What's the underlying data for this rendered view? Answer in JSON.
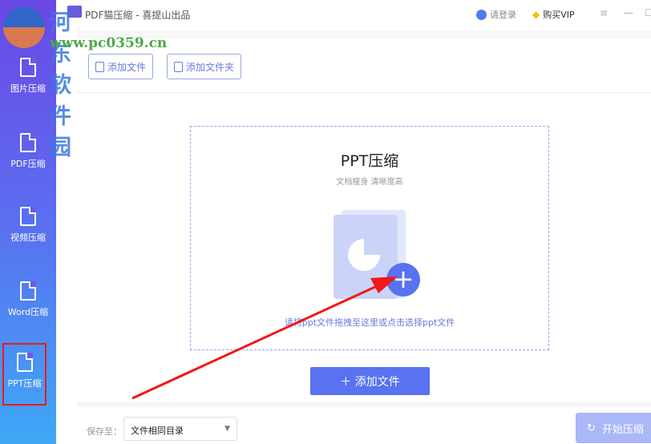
{
  "app": {
    "title": "PDF猫压缩 - 喜提山出品",
    "login": "请登录",
    "vip": "购买VIP"
  },
  "sidebar": {
    "items": [
      {
        "label": "图片压缩"
      },
      {
        "label": "PDF压缩"
      },
      {
        "label": "视频压缩"
      },
      {
        "label": "Word压缩"
      },
      {
        "label": "PPT压缩"
      }
    ]
  },
  "toolbar": {
    "add_file": "添加文件",
    "add_folder": "添加文件夹"
  },
  "drop": {
    "title": "PPT压缩",
    "subtitle": "文档瘦身  清晰度高",
    "hint": "请将ppt文件拖拽至这里或点击选择ppt文件"
  },
  "add_button": "＋ 添加文件",
  "bottom": {
    "save_label": "保存至：",
    "save_value": "文件相同目录",
    "start": "开始压缩"
  },
  "watermark": {
    "name": "河东软件园",
    "url": "www.pc0359.cn"
  },
  "colors": {
    "accent": "#5872f0",
    "annotation": "#f01818"
  }
}
